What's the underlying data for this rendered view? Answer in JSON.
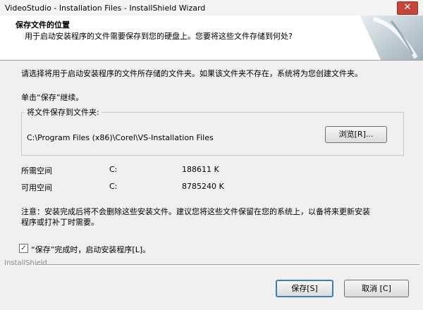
{
  "window": {
    "title": "VideoStudio - Installation Files - InstallShield Wizard",
    "close_label": "✕"
  },
  "header": {
    "title": "保存文件的位置",
    "description": "用于启动安装程序的文件需要保存到您的硬盘上。您要将这些文件存储到何处?"
  },
  "body": {
    "instruction": "请选择将用于启动安装程序的文件所存储的文件夹。如果该文件夹不存在，系统将为您创建文件夹。",
    "continue_hint": "单击“保存”继续。",
    "folder_group": {
      "label": "将文件保存到文件夹:",
      "path": "C:\\Program Files (x86)\\Corel\\VS-Installation Files",
      "browse_label": "浏览[R]..."
    },
    "space": [
      {
        "label": "所需空间",
        "drive": "C:",
        "value": "188611 K"
      },
      {
        "label": "可用空间",
        "drive": "C:",
        "value": "8785240 K"
      }
    ],
    "note": "注意：安装完成后将不会删除这些安装文件。建议您将这些文件保留在您的系统上，以备将来更新安装程序或打补丁时需要。",
    "launch_checkbox": {
      "label": "“保存”完成时，启动安装程序[L]。",
      "checked": true
    }
  },
  "footer": {
    "brand": "InstallShield",
    "save_label": "保存[S]",
    "cancel_label": "取消 [C]"
  }
}
